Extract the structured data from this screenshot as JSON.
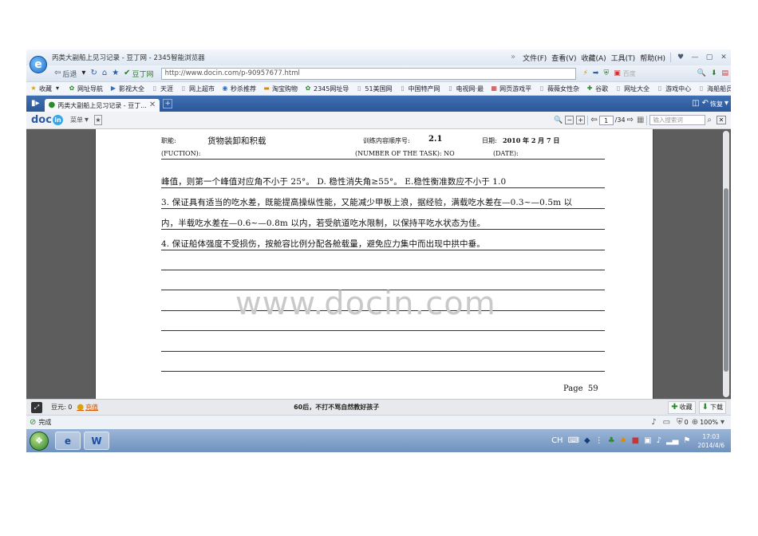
{
  "window": {
    "title": "丙类大副船上见习记录 - 豆丁网 - 2345智能浏览器",
    "menu": [
      "文件(F)",
      "查看(V)",
      "收藏(A)",
      "工具(T)",
      "帮助(H)"
    ]
  },
  "nav": {
    "back_label": "后退",
    "site_badge": "豆丁网",
    "url": "http://www.docin.com/p-90957677.html",
    "search_placeholder": "百度"
  },
  "favorites": {
    "label": "收藏",
    "items": [
      "网址导航",
      "影视大全",
      "天涯",
      "网上超市",
      "秒杀推荐",
      "淘宝购物",
      "2345网址导",
      "51美国网",
      "中国特产网",
      "电视网·最",
      "网页游戏平",
      "薇薇女性杂",
      "谷歌",
      "网址大全",
      "游戏中心",
      "海船船员电"
    ]
  },
  "tabs": [
    {
      "label": "丙类大副船上见习记录 - 豆丁..."
    }
  ],
  "tabbar": {
    "restore_label": "恢复"
  },
  "doc_toolbar": {
    "logo_text": "doc",
    "logo_badge": "in",
    "menu_label": "菜单",
    "page_current": "1",
    "page_total": "/34",
    "search_placeholder": "输入搜索词"
  },
  "document": {
    "header": {
      "position_label": "职能:",
      "position_value": "货物装卸和积载",
      "task_label": "训练内容顺序号:",
      "task_value": "2.1",
      "date_label": "日期:",
      "date_value": "2010 年 2 月 7 日",
      "function_en": "(FUCTION):",
      "task_en": "(NUMBER OF THE TASK): NO",
      "date_en": "(DATE):"
    },
    "lines": [
      "峰值，则第一个峰值对应角不小于 25°。 D. 稳性消失角≥55°。 E.稳性衡准数应不小于 1.0",
      " 3. 保证具有适当的吃水差，既能提高操纵性能，又能减少甲板上浪，据经验，满载吃水差在—0.3~—0.5m 以",
      "内，半载吃水差在—0.6~—0.8m 以内，若受航道吃水限制，以保持平吃水状态为佳。",
      " 4. 保证船体强度不受损伤，按舱容比例分配各舱载量，避免应力集中而出现中拱中垂。"
    ],
    "watermark": "www.docin.com",
    "page_label": "Page",
    "page_number": "59"
  },
  "bottombar": {
    "score_label": "豆元: 0",
    "recharge_label": "充值",
    "ad_text": "60后，不打不骂自然教好孩子",
    "collect_label": "收藏",
    "download_label": "下载"
  },
  "statusbar": {
    "status": "完成",
    "counter": "0",
    "zoom": "100%"
  },
  "taskbar": {
    "time": "17:03",
    "date": "2014/4/6"
  }
}
